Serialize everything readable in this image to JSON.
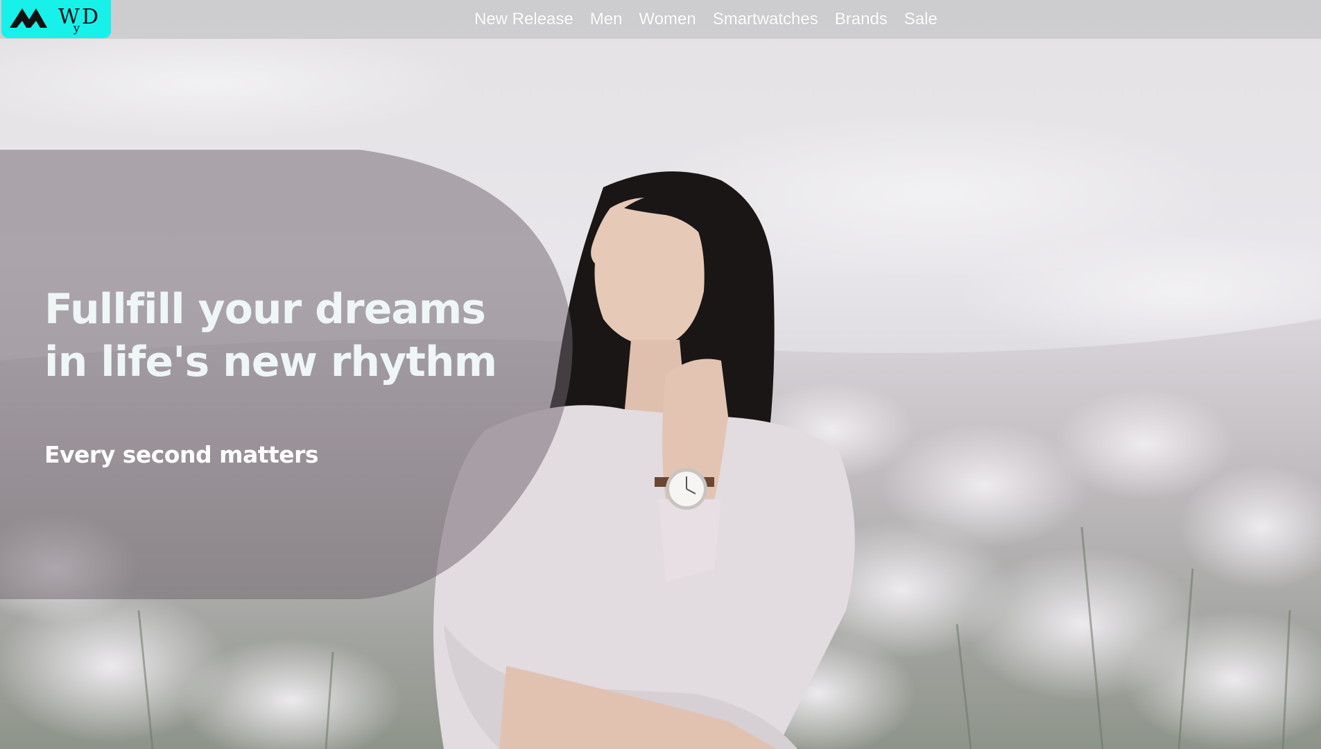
{
  "brand": {
    "logo_text": "MWyD",
    "accent_color": "#18f0ea"
  },
  "nav": {
    "items": [
      {
        "label": "New Release"
      },
      {
        "label": "Men"
      },
      {
        "label": "Women"
      },
      {
        "label": "Smartwatches"
      },
      {
        "label": "Brands"
      },
      {
        "label": "Sale"
      }
    ]
  },
  "hero": {
    "headline": "Fullfill your dreams in life's new rhythm",
    "tagline": "Every second matters",
    "image_subject": "woman-wearing-watch-in-flower-field"
  }
}
